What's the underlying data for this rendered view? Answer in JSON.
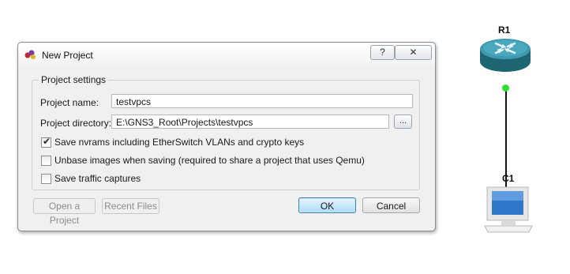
{
  "dialog": {
    "title": "New Project",
    "help_glyph": "?",
    "close_glyph": "✕",
    "group_title": "Project settings",
    "project_name_label": "Project name:",
    "project_name_value": "testvpcs",
    "project_dir_label": "Project directory:",
    "project_dir_value": "E:\\GNS3_Root\\Projects\\testvpcs",
    "browse_label": "...",
    "options": [
      {
        "label": "Save nvrams including EtherSwitch VLANs and crypto keys",
        "checked": true
      },
      {
        "label": "Unbase images when saving (required to share a project that uses Qemu)",
        "checked": false
      },
      {
        "label": "Save traffic captures",
        "checked": false
      }
    ],
    "buttons": {
      "open_project": "Open a Project",
      "recent_files": "Recent Files",
      "ok": "OK",
      "cancel": "Cancel"
    }
  },
  "topology": {
    "router_label": "R1",
    "pc_label": "C1",
    "link_status_color": "#2ee02e",
    "router_color": "#3a8ea1"
  }
}
